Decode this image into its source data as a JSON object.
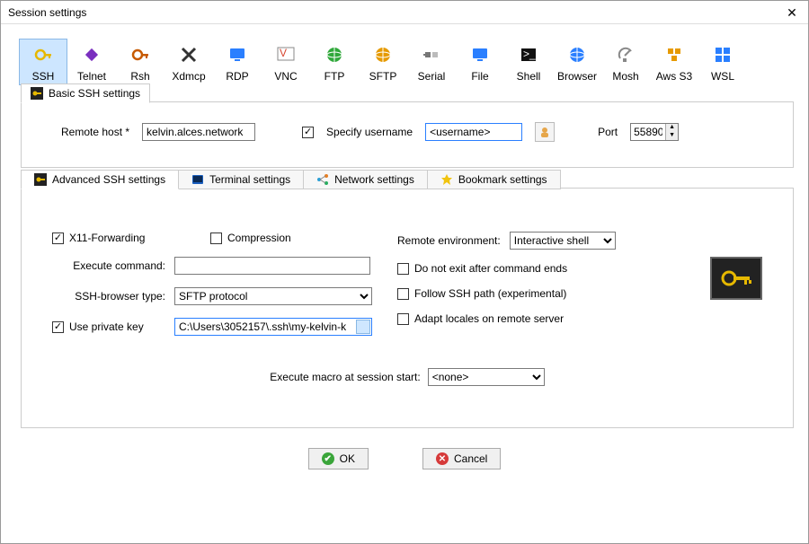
{
  "window": {
    "title": "Session settings"
  },
  "protocols": [
    {
      "label": "SSH",
      "color": "#e6b800",
      "shape": "key",
      "selected": true
    },
    {
      "label": "Telnet",
      "color": "#7a2fbf",
      "shape": "diamond"
    },
    {
      "label": "Rsh",
      "color": "#c75a00",
      "shape": "key"
    },
    {
      "label": "Xdmcp",
      "color": "#333333",
      "shape": "xwin"
    },
    {
      "label": "RDP",
      "color": "#2a7fff",
      "shape": "screen"
    },
    {
      "label": "VNC",
      "color": "#d6452f",
      "shape": "vnc"
    },
    {
      "label": "FTP",
      "color": "#2fa83a",
      "shape": "globe"
    },
    {
      "label": "SFTP",
      "color": "#e69a00",
      "shape": "globe"
    },
    {
      "label": "Serial",
      "color": "#777777",
      "shape": "plug"
    },
    {
      "label": "File",
      "color": "#2a7fff",
      "shape": "screen"
    },
    {
      "label": "Shell",
      "color": "#111111",
      "shape": "term"
    },
    {
      "label": "Browser",
      "color": "#2a7fff",
      "shape": "globe"
    },
    {
      "label": "Mosh",
      "color": "#888888",
      "shape": "dish"
    },
    {
      "label": "Aws S3",
      "color": "#e69a00",
      "shape": "cubes"
    },
    {
      "label": "WSL",
      "color": "#2a7fff",
      "shape": "win"
    }
  ],
  "basic": {
    "tab_label": "Basic SSH settings",
    "remote_host_label": "Remote host *",
    "remote_host": "kelvin.alces.network",
    "specify_username_label": "Specify username",
    "specify_username_checked": true,
    "username": "<username>",
    "port_label": "Port",
    "port": "55890"
  },
  "adv_tabs": {
    "advanced": "Advanced SSH settings",
    "terminal": "Terminal settings",
    "network": "Network settings",
    "bookmark": "Bookmark settings"
  },
  "adv": {
    "x11_label": "X11-Forwarding",
    "x11_checked": true,
    "compression_label": "Compression",
    "compression_checked": false,
    "remote_env_label": "Remote environment:",
    "remote_env_value": "Interactive shell",
    "execute_cmd_label": "Execute command:",
    "execute_cmd_value": "",
    "no_exit_label": "Do not exit after command ends",
    "no_exit_checked": false,
    "browser_type_label": "SSH-browser type:",
    "browser_type_value": "SFTP protocol",
    "follow_path_label": "Follow SSH path (experimental)",
    "follow_path_checked": false,
    "use_pk_label": "Use private key",
    "use_pk_checked": true,
    "pk_path": "C:\\Users\\3052157\\.ssh\\my-kelvin-k",
    "adapt_locales_label": "Adapt locales on remote server",
    "adapt_locales_checked": false,
    "macro_label": "Execute macro at session start:",
    "macro_value": "<none>"
  },
  "buttons": {
    "ok": "OK",
    "cancel": "Cancel"
  }
}
